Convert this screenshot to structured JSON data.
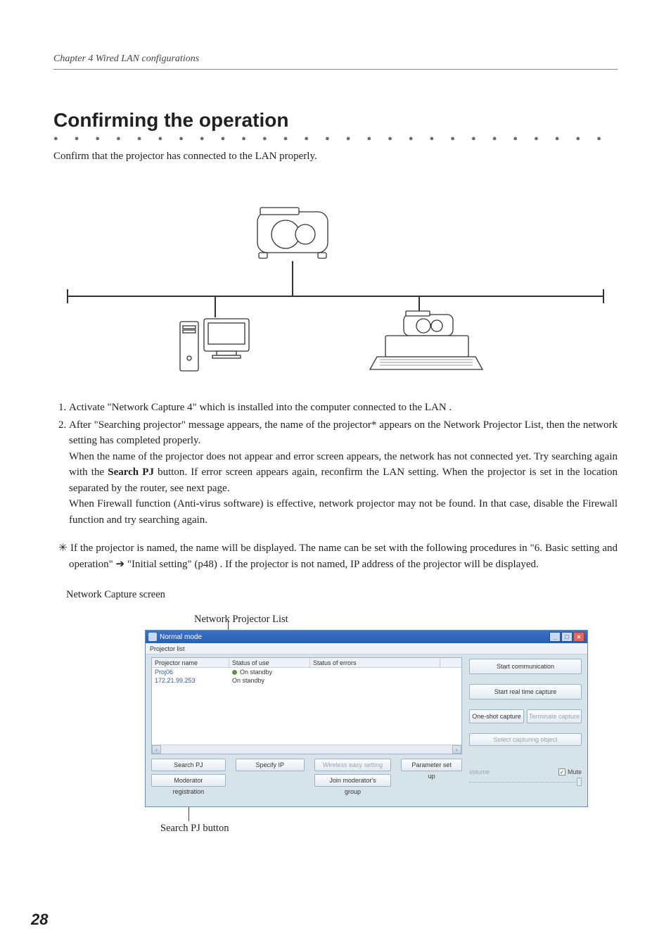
{
  "chapter_header": "Chapter 4 Wired LAN configurations",
  "title": "Confirming the operation",
  "intro": "Confirm that the projector has connected to the LAN properly.",
  "steps": {
    "s1": "Activate \"Network Capture 4\" which is installed into the computer connected to the LAN .",
    "s2_p1_a": "After \"Searching projector\" message appears, the name of the projector* appears on the Network Projector List, then the network setting has completed properly.",
    "s2_p2_a": "When the name of the projector does not appear and error screen appears, the network has not connected yet. Try searching again with the ",
    "s2_p2_bold": "Search PJ",
    "s2_p2_b": " button. If error screen appears again, reconfirm the LAN setting. When the projector is set in the location separated by the router, see next page.",
    "s2_p3": "When Firewall function (Anti-virus software) is effective, network projector may not be found.  In that case, disable the Firewall function and try searching again."
  },
  "note": {
    "lead": "✳ ",
    "a": "If the projector is named, the name will be displayed. The name can be set with the following procedures in \"6. Basic setting and operation\" ",
    "arrow": "➔",
    "b": " \"Initial setting\" (p48) . If the projector is not named, IP address of the projector will be displayed."
  },
  "captions": {
    "network_capture_screen": "Network Capture screen",
    "network_projector_list": "Network Projector List",
    "search_pj_button": "Search PJ button"
  },
  "app": {
    "title": "Normal mode",
    "menu": "Projector list",
    "cols": {
      "name": "Projector name",
      "status": "Status of use",
      "errors": "Status of errors"
    },
    "rows": [
      {
        "name": "Proj06",
        "status": "On standby",
        "errors": ""
      },
      {
        "name": "172.21.99.253",
        "status": "On standby",
        "errors": ""
      }
    ],
    "buttons": {
      "search_pj": "Search PJ",
      "moderator_reg": "Moderator registration",
      "specify_ip": "Specify IP",
      "wireless_easy": "Wireless easy setting",
      "join_mod": "Join moderator's group",
      "param_set": "Parameter set up"
    },
    "right": {
      "start_comm": "Start communication",
      "start_rt": "Start real time capture",
      "one_shot": "One-shot capture",
      "terminate": "Terminate capture",
      "select_obj": "Select capturing object",
      "volume": "volume",
      "mute": "Mute"
    }
  },
  "page_number": "28"
}
